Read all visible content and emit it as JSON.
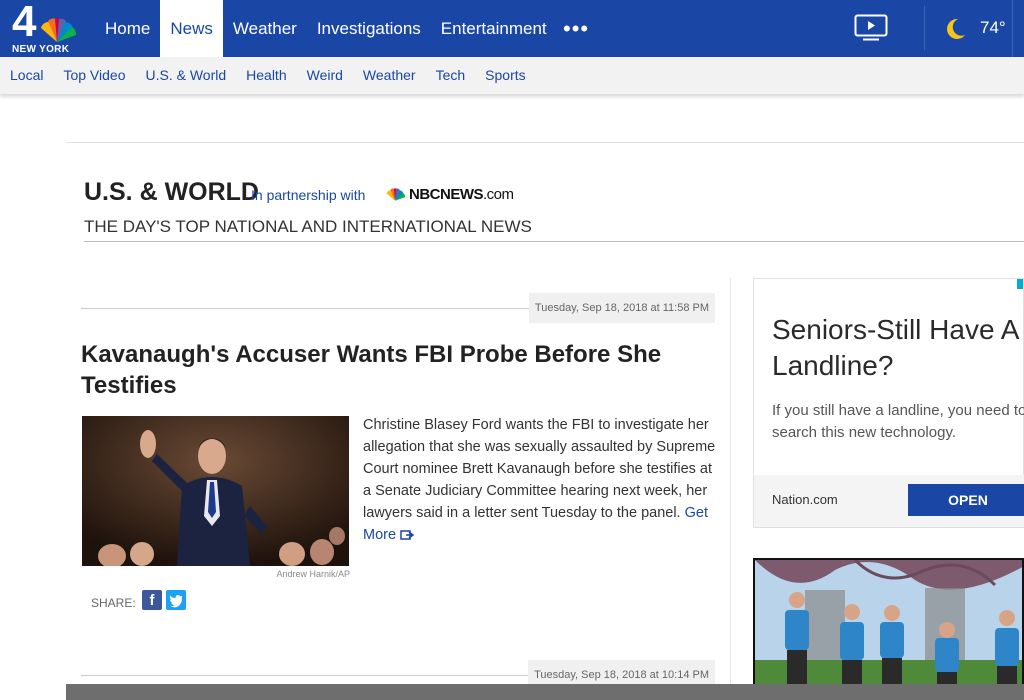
{
  "brand": {
    "logo_number": "4",
    "logo_city": "NEW YORK"
  },
  "mainnav": {
    "items": [
      "Home",
      "News",
      "Weather",
      "Investigations",
      "Entertainment"
    ],
    "active": "News",
    "more": "•••"
  },
  "weather": {
    "temp": "74°"
  },
  "subnav": {
    "items": [
      "Local",
      "Top Video",
      "U.S. & World",
      "Health",
      "Weird",
      "Weather",
      "Tech",
      "Sports"
    ]
  },
  "section": {
    "title": "U.S. & WORLD",
    "partner_text": "In partnership with",
    "partner_logo_main": "NBCNEWS",
    "partner_logo_suffix": ".com",
    "subtitle": "THE DAY'S TOP NATIONAL AND INTERNATIONAL NEWS"
  },
  "article": {
    "date": "Tuesday, Sep 18, 2018 at 11:58 PM",
    "headline": "Kavanaugh's Accuser Wants FBI Probe Before She Testifies",
    "photo_credit": "Andrew Harnik/AP",
    "summary": "Christine Blasey Ford wants the FBI to investigate her allegation that she was sexually assaulted by Supreme Court nominee Brett Kavanaugh before she testifies at a Senate Judiciary Committee hearing next week, her lawyers said in a letter sent Tuesday to the panel.",
    "get_more": "Get More",
    "share_label": "SHARE:"
  },
  "next_article": {
    "date": "Tuesday, Sep 18, 2018 at 10:14 PM"
  },
  "ad": {
    "title": "Seniors-Still Have A Landline?",
    "body": "If you still have a landline, you need to search this new technology.",
    "source": "Nation.com",
    "cta": "OPEN"
  },
  "colors": {
    "brand_blue": "#1a47a5",
    "facebook": "#3b5998",
    "twitter": "#1da1f2"
  }
}
